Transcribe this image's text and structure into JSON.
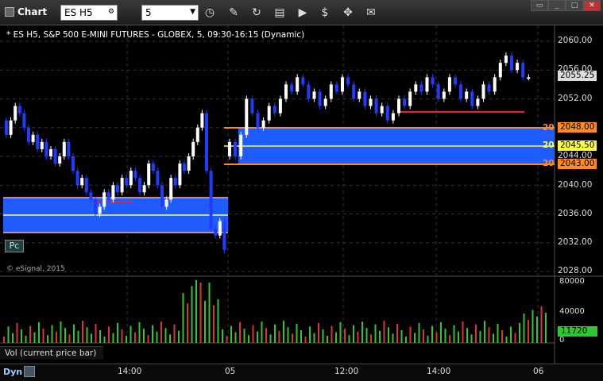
{
  "window": {
    "title": "Chart"
  },
  "toolbar": {
    "symbol": "ES H5",
    "interval": "5",
    "icons": [
      "clock-icon",
      "pencil-icon",
      "refresh-icon",
      "tag-icon",
      "play-icon",
      "currency-icon",
      "draw-tool-icon",
      "chat-icon"
    ]
  },
  "header": {
    "text": "* ES H5, S&P 500 E-MINI FUTURES - GLOBEX, 5, 09:30-16:15 (Dynamic)"
  },
  "watermark": "© eSignal, 2015",
  "pc_label": "Pc",
  "price_axis": [
    "2060.00",
    "2056.00",
    "2052.00",
    "2048.00",
    "2044.00",
    "2040.00",
    "2036.00",
    "2032.00",
    "2028.00"
  ],
  "price_tags": {
    "last": "2055.25",
    "upper": "2048.00",
    "mid": "2045.50",
    "lower": "2043.00",
    "level_text_upper": "20",
    "level_text_mid": "20",
    "level_text_lower": "20"
  },
  "volume": {
    "label": "Vol (current price bar)",
    "axis": [
      "80000",
      "40000",
      "0"
    ],
    "current": "11720"
  },
  "time_axis": [
    "14:00",
    "05",
    "12:00",
    "14:00",
    "06"
  ],
  "bottom": {
    "mode": "Dyn"
  },
  "colors": {
    "zone": "#1f5cff",
    "bull": "#ffffff",
    "bear": "#1f3cff",
    "vol_up": "#2ec82e",
    "vol_down": "#d33",
    "level": "#ff8a1e"
  },
  "chart_data": {
    "type": "candlestick",
    "price_range": [
      2028,
      2062
    ],
    "volume_range": [
      0,
      80000
    ]
  }
}
